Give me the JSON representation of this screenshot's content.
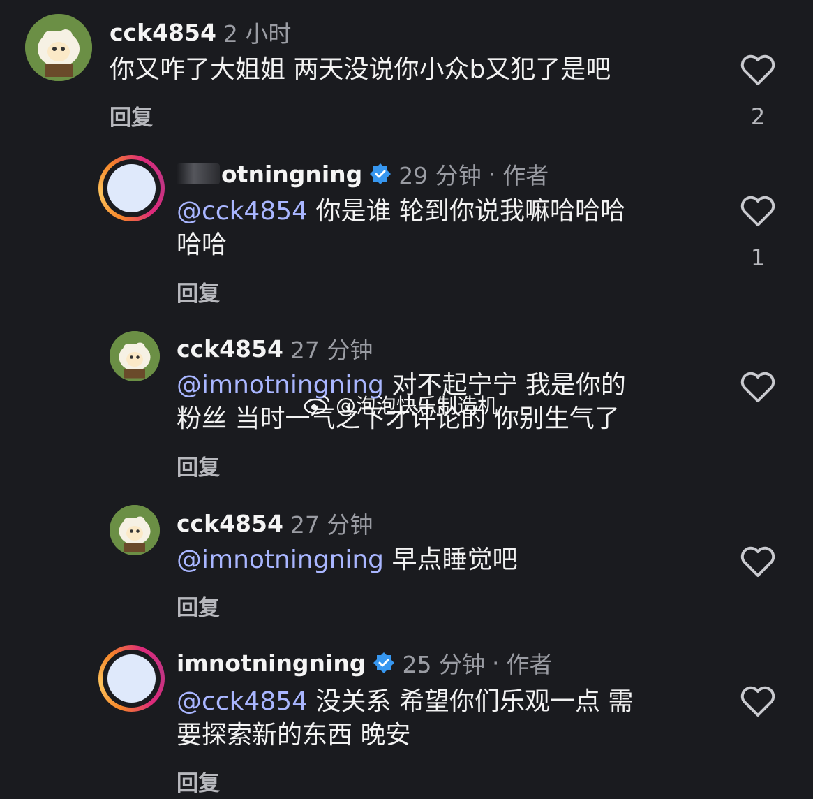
{
  "comments": [
    {
      "username": "cck4854",
      "time": "2 小时",
      "mention": "",
      "text": "你又咋了大姐姐 两天没说你小众b又犯了是吧",
      "reply_label": "回复",
      "likes": "2"
    },
    {
      "username": "otningning",
      "time": "29 分钟",
      "separator": "·",
      "author_label": "作者",
      "mention": "@cck4854",
      "text_line1": " 你是谁 轮到你说我嘛哈哈哈",
      "text_line2": "哈哈",
      "reply_label": "回复",
      "likes": "1"
    },
    {
      "username": "cck4854",
      "time": "27 分钟",
      "mention": "@imnotningning",
      "text_line1": " 对不起宁宁 我是你的",
      "text_line2": "粉丝 当时一气之下才评论的 你别生气了",
      "reply_label": "回复"
    },
    {
      "username": "cck4854",
      "time": "27 分钟",
      "mention": "@imnotningning",
      "text_line1": " 早点睡觉吧",
      "reply_label": "回复"
    },
    {
      "username": "imnotningning",
      "time": "25 分钟",
      "separator": "·",
      "author_label": "作者",
      "mention": "@cck4854",
      "text_line1": " 没关系 希望你们乐观一点 需",
      "text_line2": "要探索新的东西 晚安",
      "reply_label": "回复"
    }
  ],
  "watermark": "@泡泡快乐制造机",
  "icons": [
    "heart-outline-icon",
    "verified-badge-icon",
    "weibo-logo-icon"
  ],
  "colors": {
    "background": "#1a1b1f",
    "mention": "#a9b6ff",
    "verified": "#3797f0"
  }
}
